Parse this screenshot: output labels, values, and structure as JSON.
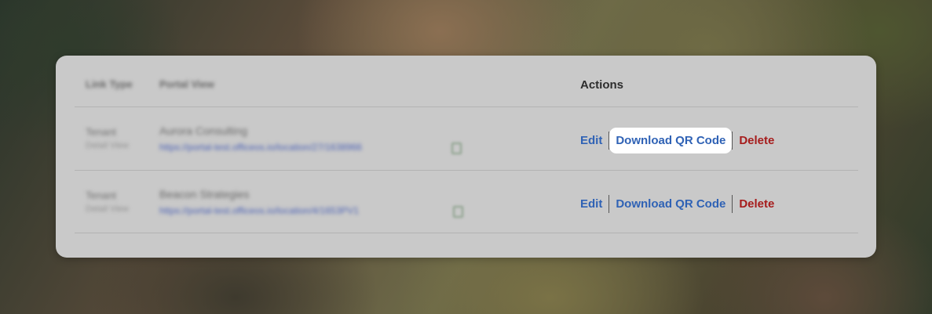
{
  "table": {
    "headers": {
      "link_type": "Link Type",
      "portal_view": "Portal View",
      "actions": "Actions"
    },
    "rows": [
      {
        "link_type": "Tenant",
        "link_subtype": "Detail View",
        "name": "Aurora Consulting",
        "url": "https://portal-test.officeos.io/location/27/1638966",
        "actions": {
          "edit": "Edit",
          "download": "Download QR Code",
          "delete": "Delete"
        }
      },
      {
        "link_type": "Tenant",
        "link_subtype": "Detail View",
        "name": "Beacon Strategies",
        "url": "https://portal-test.officeos.io/location/4/1653PV1",
        "actions": {
          "edit": "Edit",
          "download": "Download QR Code",
          "delete": "Delete"
        }
      }
    ]
  },
  "colors": {
    "link_blue": "#2f62b5",
    "delete_red": "#a61c1c",
    "card_bg": "#c9c9c9",
    "highlight": "#ffffff"
  },
  "icons": {
    "copy": "copy-icon"
  }
}
